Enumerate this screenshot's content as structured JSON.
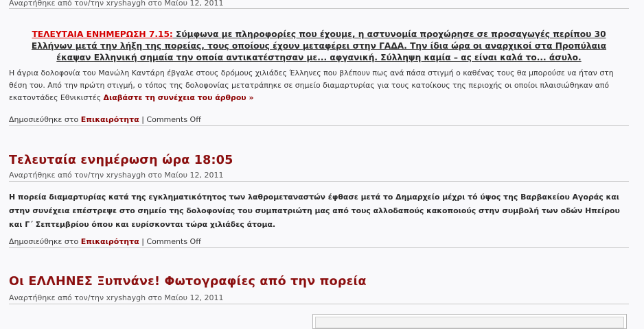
{
  "post1": {
    "meta": "Αναρτήθηκε από τον/την xryshaygh στο Μαίου 12, 2011",
    "update_label": "ΤΕΛΕΥΤΑΙΑ ΕΝΗΜΕΡΩΣΗ 7.15:",
    "update_text_line1": " Σύμφωνα με πληροφορίες που έχουμε, η αστυνομία προχώρησε σε προσαγωγές περίπου 30",
    "update_text_line2": "Ελλήνων μετά την λήξη της πορείας, τους οποίους έχουν μεταφέρει στην ΓΑΔΑ. Την ίδια ώρα οι αναρχικοί στα Προπύλαια",
    "update_text_line3": "έκαψαν Ελληνική σημαία την οποία αντικατέστησαν με... αφγανική. Σύλληψη καμία – ας είναι καλά το... άσυλο.",
    "excerpt": "Η άγρια δολοφονία του Μανώλη Καντάρη έβγαλε στους δρόμους χιλιάδες Έλληνες που βλέπουν πως ανά πάσα στιγμή ο καθένας τους θα μπορούσε να ήταν στη θέση του. Από την πρώτη στιγμή, ο τόπος της δολοφονίας μετατράπηκε σε σημείο διαμαρτυρίας για τους κατοίκους της περιοχής οι οποίοι πλαισιώθηκαν από εκατοντάδες Εθνικιστές ",
    "read_more": "Διαβάστε τη συνέχεια του άρθρου »",
    "published_in": "Δημοσιεύθηκε στο ",
    "category": "Επικαιρότητα",
    "separator": " | ",
    "comments": "Comments Off"
  },
  "post2": {
    "title": "Τελευταία ενημέρωση ώρα 18:05",
    "meta": "Αναρτήθηκε από τον/την xryshaygh στο Μαίου 12, 2011",
    "body": "Η πορεία διαμαρτυρίας κατά της εγκληματικότητος των λαθρομεταναστών έφθασε μετά το Δημαρχείο μέχρι τό ύψος της Βαρβακείου Αγοράς και στην συνέχεια επέστρεψε στο σημείο της δολοφονίας του συμπατριώτη μας από τους αλλοδαπούς κακοποιούς στην συμβολή των οδών Ηπείρου και Γ΄ Σεπτεμβρίου όπου και ευρίσκονται τώρα χιλιάδες άτομα.",
    "published_in": "Δημοσιεύθηκε στο ",
    "category": "Επικαιρότητα",
    "separator": " | ",
    "comments": "Comments Off"
  },
  "post3": {
    "title": "Οι ΕΛΛΗΝΕΣ Ξυπνάνε! Φωτογραφίες από την πορεία",
    "meta": "Αναρτήθηκε από τον/την xryshaygh στο Μαίου 12, 2011"
  }
}
